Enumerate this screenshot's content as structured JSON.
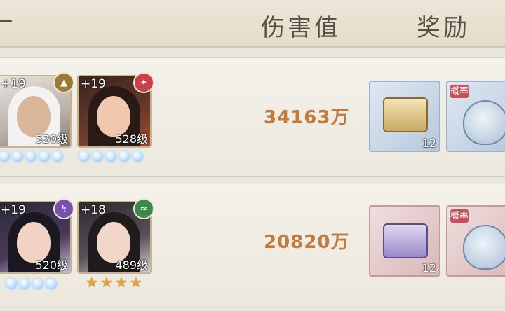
{
  "header": {
    "partial_label": "",
    "damage_label": "伤害值",
    "reward_label": "奖励"
  },
  "rows": [
    {
      "heroes": [
        {
          "plus": "+19",
          "level": "520级",
          "badge_icon": "compass-icon",
          "badge_color": "#9a7a3a"
        },
        {
          "plus": "+19",
          "level": "528级",
          "badge_icon": "flame-icon",
          "badge_color": "#c8414a"
        }
      ],
      "damage": "34163万",
      "rewards": [
        {
          "icon": "treasure-chest-icon",
          "qty": "12"
        },
        {
          "icon": "lucky-bag-icon",
          "tag": "概率"
        }
      ]
    },
    {
      "heroes": [
        {
          "plus": "+19",
          "level": "520级",
          "badge_icon": "lightning-icon",
          "badge_color": "#7a4fb0"
        },
        {
          "plus": "+18",
          "level": "489级",
          "badge_icon": "wave-icon",
          "badge_color": "#3b8a4c"
        }
      ],
      "damage": "20820万",
      "rewards": [
        {
          "icon": "treasure-chest-icon",
          "qty": "12"
        },
        {
          "icon": "lucky-bag-icon",
          "tag": "概率"
        }
      ]
    }
  ],
  "colors": {
    "accent_damage": "#c27b3e",
    "header_text": "#5a4f43"
  }
}
